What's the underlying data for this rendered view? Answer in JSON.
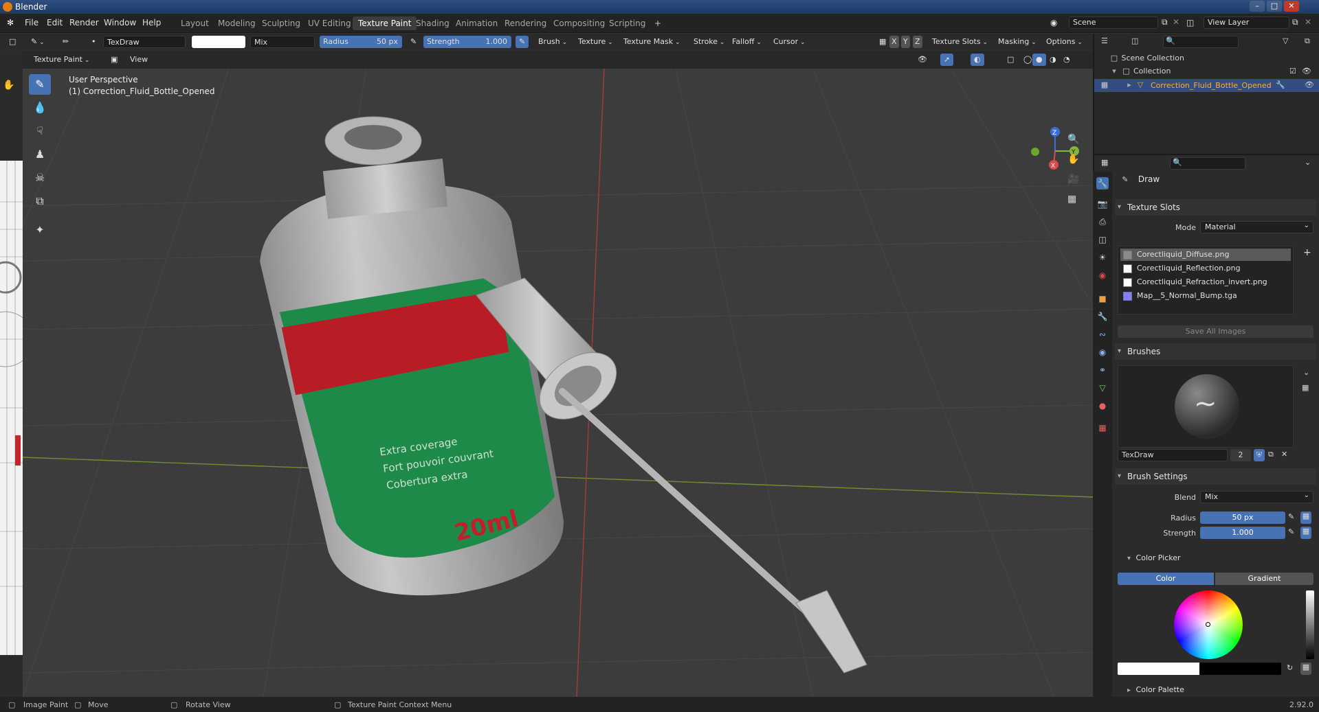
{
  "window": {
    "title": "Blender"
  },
  "menu": {
    "items": [
      "File",
      "Edit",
      "Render",
      "Window",
      "Help"
    ]
  },
  "workspaces": [
    "Layout",
    "Modeling",
    "Sculpting",
    "UV Editing",
    "Texture Paint",
    "Shading",
    "Animation",
    "Rendering",
    "Compositing",
    "Scripting"
  ],
  "active_workspace": "Texture Paint",
  "scene": {
    "name": "Scene",
    "view_layer": "View Layer"
  },
  "tool_header": {
    "brush_name": "TexDraw",
    "blend": "Mix",
    "radius_label": "Radius",
    "radius_value": "50 px",
    "strength_label": "Strength",
    "strength_value": "1.000",
    "menus": [
      "Brush",
      "Texture",
      "Texture Mask",
      "Stroke",
      "Falloff",
      "Cursor"
    ],
    "axes": [
      "X",
      "Y",
      "Z"
    ],
    "right_menus": [
      "Texture Slots",
      "Masking",
      "Options"
    ]
  },
  "view_header": {
    "mode": "Texture Paint",
    "view": "View"
  },
  "viewport": {
    "perspective": "User Perspective",
    "object_label": "(1) Correction_Fluid_Bottle_Opened",
    "label_lines": [
      "Extra coverage",
      "Fort pouvoir couvrant",
      "Cobertura extra"
    ],
    "volume": "20ml",
    "gizmo": {
      "x": "X",
      "y": "Y",
      "z": "Z"
    },
    "colors": {
      "label_green": "#1e8a4a",
      "label_red": "#b81c24",
      "bottle": "#b9b9b9"
    }
  },
  "outliner": {
    "scene_collection": "Scene Collection",
    "collection": "Collection",
    "object": "Correction_Fluid_Bottle_Opened"
  },
  "properties": {
    "tool_name": "Draw",
    "texture_slots": {
      "title": "Texture Slots",
      "mode_label": "Mode",
      "mode_value": "Material",
      "slots": [
        {
          "name": "Corectliquid_Diffuse.png",
          "swatch": "#8a8a8a"
        },
        {
          "name": "Corectliquid_Reflection.png",
          "swatch": "#ffffff"
        },
        {
          "name": "Corectliquid_Refraction_invert.png",
          "swatch": "#ffffff"
        },
        {
          "name": "Map__5_Normal_Bump.tga",
          "swatch": "#8080ff"
        }
      ],
      "save_all": "Save All Images"
    },
    "brushes": {
      "title": "Brushes",
      "brush_name": "TexDraw",
      "users": "2"
    },
    "brush_settings": {
      "title": "Brush Settings",
      "blend_label": "Blend",
      "blend_value": "Mix",
      "radius_label": "Radius",
      "radius_value": "50 px",
      "strength_label": "Strength",
      "strength_value": "1.000"
    },
    "color_picker": {
      "title": "Color Picker",
      "tab_color": "Color",
      "tab_gradient": "Gradient"
    },
    "color_palette": {
      "title": "Color Palette"
    }
  },
  "status": {
    "items": [
      "Image Paint",
      "Move",
      "Rotate View",
      "Texture Paint Context Menu"
    ],
    "version": "2.92.0"
  }
}
